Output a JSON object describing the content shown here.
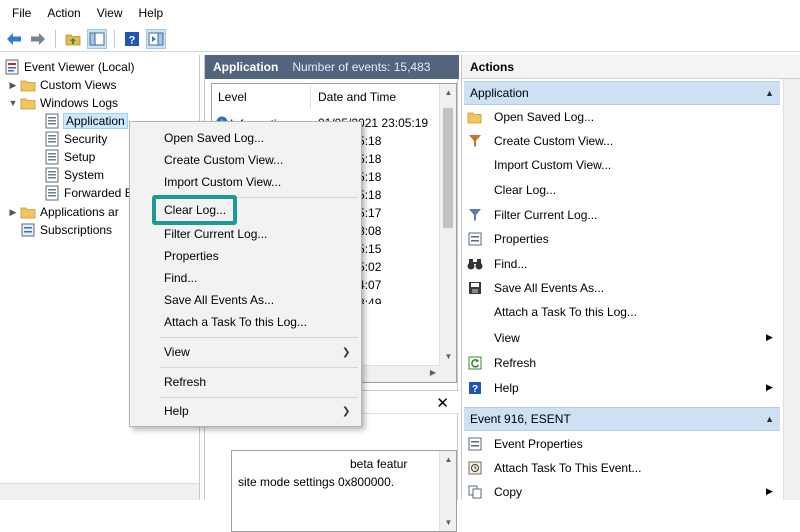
{
  "menubar": {
    "items": [
      "File",
      "Action",
      "View",
      "Help"
    ]
  },
  "toolbar": {
    "icons": [
      "back-icon",
      "forward-icon",
      "folder-up-icon",
      "console-tree-icon",
      "help-icon",
      "action-pane-icon"
    ]
  },
  "tree": {
    "items": [
      {
        "label": "Event Viewer (Local)",
        "icon": "event-viewer-icon"
      },
      {
        "label": "Custom Views",
        "icon": "folder-icon"
      },
      {
        "label": "Windows Logs",
        "icon": "folder-icon"
      },
      {
        "label": "Application",
        "icon": "log-icon"
      },
      {
        "label": "Security",
        "icon": "log-icon"
      },
      {
        "label": "Setup",
        "icon": "log-icon"
      },
      {
        "label": "System",
        "icon": "log-icon"
      },
      {
        "label": "Forwarded E",
        "icon": "log-icon"
      },
      {
        "label": "Applications ar",
        "icon": "folder-icon"
      },
      {
        "label": "Subscriptions",
        "icon": "subscriptions-icon"
      }
    ]
  },
  "middle": {
    "title": "Application",
    "count": "Number of events: 15,483",
    "columns": {
      "level": "Level",
      "datetime": "Date and Time"
    },
    "rows": [
      {
        "level": "Information",
        "datetime": "01/05/2021 23:05:19"
      },
      {
        "level": "",
        "datetime": "21 23:05:18"
      },
      {
        "level": "",
        "datetime": "21 23:05:18"
      },
      {
        "level": "",
        "datetime": "21 23:05:18"
      },
      {
        "level": "",
        "datetime": "21 23:05:18"
      },
      {
        "level": "",
        "datetime": "21 23:05:17"
      },
      {
        "level": "",
        "datetime": "21 22:58:08"
      },
      {
        "level": "",
        "datetime": "21 22:55:15"
      },
      {
        "level": "",
        "datetime": "21 22:55:02"
      },
      {
        "level": "",
        "datetime": "21 22:54:07"
      },
      {
        "level": "",
        "datetime": "21 22:53:49"
      }
    ],
    "detail_line1": "beta featur",
    "detail_line2": "site mode settings 0x800000.",
    "close_glyph": "✕"
  },
  "actions": {
    "title": "Actions",
    "section1": "Application",
    "items1": [
      {
        "label": "Open Saved Log...",
        "icon": "open-folder-icon"
      },
      {
        "label": "Create Custom View...",
        "icon": "filter-create-icon"
      },
      {
        "label": "Import Custom View...",
        "icon": ""
      },
      {
        "label": "Clear Log...",
        "icon": ""
      },
      {
        "label": "Filter Current Log...",
        "icon": "filter-icon"
      },
      {
        "label": "Properties",
        "icon": "properties-icon"
      },
      {
        "label": "Find...",
        "icon": "binoculars-icon"
      },
      {
        "label": "Save All Events As...",
        "icon": "save-icon"
      },
      {
        "label": "Attach a Task To this Log...",
        "icon": ""
      },
      {
        "label": "View",
        "icon": "",
        "submenu": true
      },
      {
        "label": "Refresh",
        "icon": "refresh-icon"
      },
      {
        "label": "Help",
        "icon": "help-icon",
        "submenu": true
      }
    ],
    "section2": "Event 916, ESENT",
    "items2": [
      {
        "label": "Event Properties",
        "icon": "event-properties-icon"
      },
      {
        "label": "Attach Task To This Event...",
        "icon": "attach-task-icon"
      },
      {
        "label": "Copy",
        "icon": "copy-icon",
        "submenu": true
      }
    ]
  },
  "context_menu": {
    "items": [
      "Open Saved Log...",
      "Create Custom View...",
      "Import Custom View...",
      "Clear Log...",
      "Filter Current Log...",
      "Properties",
      "Find...",
      "Save All Events As...",
      "Attach a Task To this Log...",
      "View",
      "Refresh",
      "Help"
    ],
    "highlighted": "Clear Log..."
  },
  "colors": {
    "header_bg": "#53657d",
    "section_bg": "#cde0f4",
    "highlight_border": "#1e9a95",
    "selection": "#cce8ff"
  }
}
